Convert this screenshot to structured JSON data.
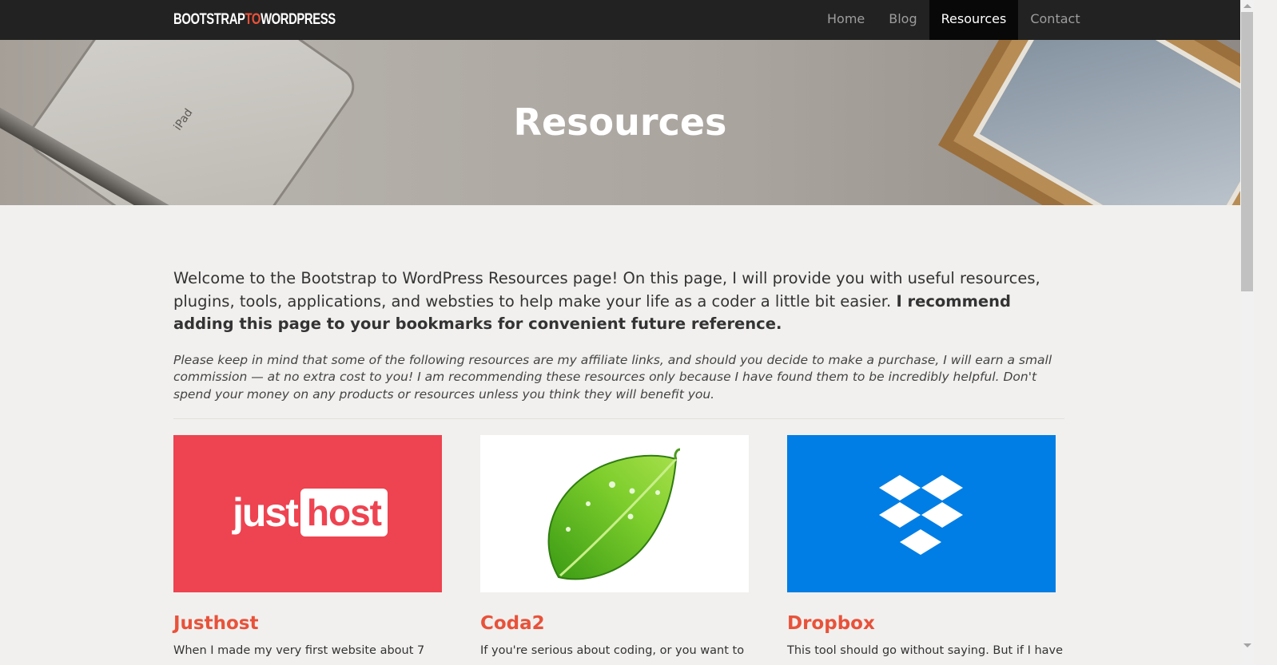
{
  "nav": {
    "brand": {
      "part1": "BOOTSTRAP",
      "part2": "TO",
      "part3": "WORDPRESS"
    },
    "items": [
      {
        "label": "Home",
        "active": false
      },
      {
        "label": "Blog",
        "active": false
      },
      {
        "label": "Resources",
        "active": true
      },
      {
        "label": "Contact",
        "active": false
      }
    ]
  },
  "hero": {
    "title": "Resources",
    "ipad_label": "iPad"
  },
  "intro": {
    "lead": "Welcome to the Bootstrap to WordPress Resources page! On this page, I will provide you with useful resources, plugins, tools, applications, and websties to help make your life as a coder a little bit easier. ",
    "lead_bold": "I recommend adding this page to your bookmarks for convenient future reference.",
    "note": "Please keep in mind that some of the following resources are my affiliate links, and should you decide to make a purchase, I will earn a small commission — at no extra cost to you! I am recommending these resources only because I have found them to be incredibly helpful. Don't spend your money on any products or resources unless you think they will benefit you."
  },
  "cards": [
    {
      "title": "Justhost",
      "text": "When I made my very first website about 7",
      "logo_just": "just",
      "logo_host": "host",
      "bg": "#ee4350"
    },
    {
      "title": "Coda2",
      "text": "If you're serious about coding, or you want to",
      "bg": "#ffffff"
    },
    {
      "title": "Dropbox",
      "text": "This tool should go without saying. But if I have",
      "bg": "#007ee5"
    }
  ],
  "colors": {
    "accent": "#e8523a",
    "nav_bg": "#222222"
  }
}
